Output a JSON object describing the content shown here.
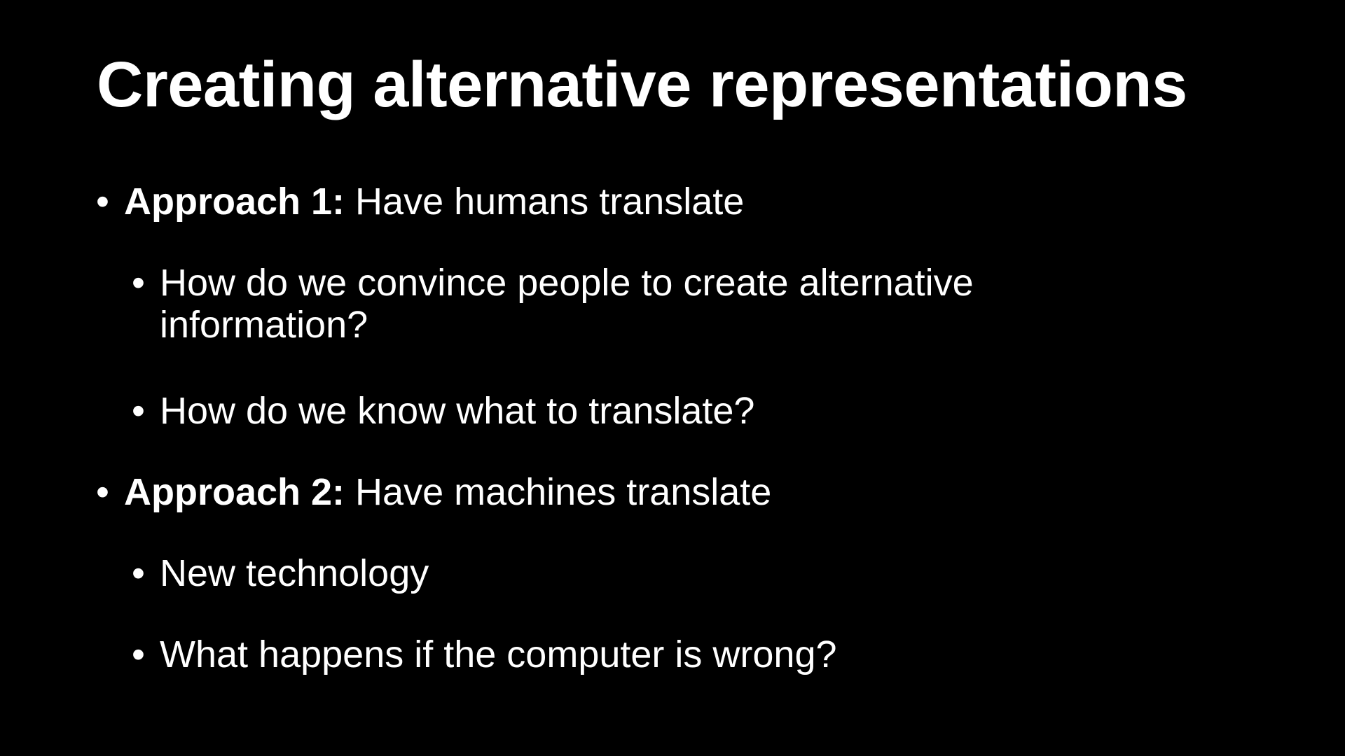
{
  "slide": {
    "title": "Creating alternative representations",
    "bullets": [
      {
        "lead": "Approach 1:",
        "text": " Have humans translate",
        "sub": [
          {
            "line1": "How do we convince people to create alternative",
            "line2": "information?"
          },
          {
            "line1": "How do we know what to translate?"
          }
        ]
      },
      {
        "lead": "Approach 2:",
        "text": " Have machines translate",
        "sub": [
          {
            "line1": "New technology"
          },
          {
            "line1": "What happens if the computer is wrong?"
          }
        ]
      }
    ],
    "bullet_glyph": "•",
    "colors": {
      "background": "#000000",
      "text": "#ffffff"
    }
  }
}
